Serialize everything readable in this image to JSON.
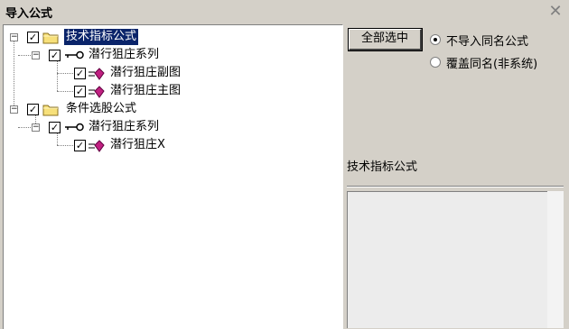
{
  "window": {
    "title": "导入公式",
    "close_glyph": "✕"
  },
  "tree": {
    "nodes": [
      {
        "label": "技术指标公式",
        "checked": true,
        "type": "folder",
        "expanded": true,
        "selected": true
      },
      {
        "label": "潜行狙庄系列",
        "checked": true,
        "type": "key",
        "expanded": true
      },
      {
        "label": "潜行狙庄副图",
        "checked": true,
        "type": "gem"
      },
      {
        "label": "潜行狙庄主图",
        "checked": true,
        "type": "gem"
      },
      {
        "label": "条件选股公式",
        "checked": true,
        "type": "folder",
        "expanded": true
      },
      {
        "label": "潜行狙庄系列",
        "checked": true,
        "type": "key",
        "expanded": true
      },
      {
        "label": "潜行狙庄X",
        "checked": true,
        "type": "gem"
      }
    ],
    "check_glyph": "✓",
    "minus_glyph": "−"
  },
  "select_all_button": "全部选中",
  "options": [
    {
      "label": "不导入同名公式",
      "checked": true
    },
    {
      "label": "覆盖同名(非系统)",
      "checked": false
    }
  ],
  "description": {
    "title": "技术指标公式",
    "text": ""
  },
  "colors": {
    "selection": "#0a246a",
    "gem": "#c02080",
    "folder": "#f7e07a"
  }
}
